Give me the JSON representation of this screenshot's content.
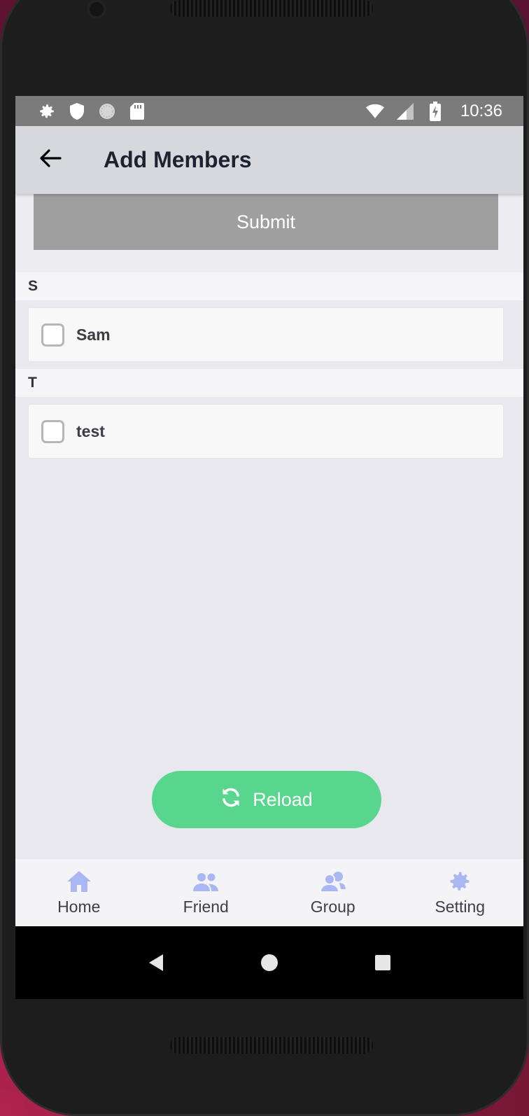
{
  "status_bar": {
    "time": "10:36",
    "left_icons": [
      "gear-icon",
      "shield-icon",
      "sync-icon",
      "sd-card-icon"
    ],
    "right_icons": [
      "wifi-icon",
      "signal-icon",
      "battery-charging-icon"
    ]
  },
  "app_bar": {
    "title": "Add Members",
    "back_icon": "arrow-left-icon"
  },
  "submit_label": "Submit",
  "sections": [
    {
      "letter": "S",
      "members": [
        {
          "name": "Sam",
          "checked": false
        }
      ]
    },
    {
      "letter": "T",
      "members": [
        {
          "name": "test",
          "checked": false
        }
      ]
    }
  ],
  "reload": {
    "label": "Reload",
    "icon": "refresh-icon"
  },
  "tabs": [
    {
      "label": "Home",
      "icon": "home-icon"
    },
    {
      "label": "Friend",
      "icon": "friends-icon"
    },
    {
      "label": "Group",
      "icon": "group-icon"
    },
    {
      "label": "Setting",
      "icon": "gear-icon"
    }
  ],
  "colors": {
    "reload_bg": "#58d68d",
    "submit_bg": "#9f9f9f",
    "tab_icon": "#a9b8f2",
    "app_bar_bg": "#d6d8dd"
  }
}
